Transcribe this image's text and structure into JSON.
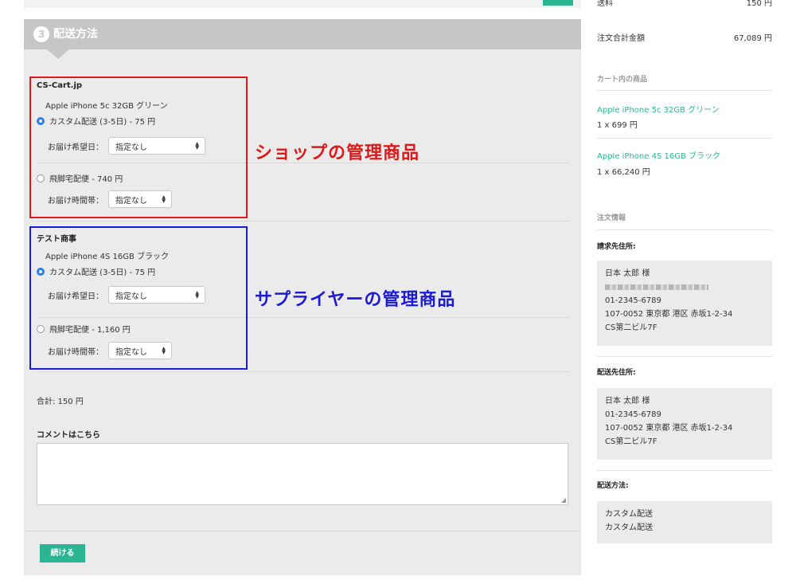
{
  "top": {
    "right_label": "送料",
    "right_value": "150 円"
  },
  "step": {
    "number": "3",
    "title": "配送方法"
  },
  "vendors": [
    {
      "name": "CS-Cart.jp",
      "product": "Apple iPhone 5c 32GB グリーン",
      "option1": "カスタム配送 (3-5日) - 75 円",
      "date_label": "お届け希望日：",
      "date_value": "指定なし",
      "option2": "飛脚宅配便 - 740 円",
      "time_label": "お届け時間帯：",
      "time_value": "指定なし"
    },
    {
      "name": "テスト商事",
      "product": "Apple iPhone 4S 16GB ブラック",
      "option1": "カスタム配送 (3-5日) - 75 円",
      "date_label": "お届け希望日：",
      "date_value": "指定なし",
      "option2": "飛脚宅配便 - 1,160 円",
      "time_label": "お届け時間帯：",
      "time_value": "指定なし"
    }
  ],
  "annotations": {
    "shop": "ショップの管理商品",
    "supplier": "サプライヤーの管理商品"
  },
  "total": "合計: 150 円",
  "comment_label": "コメントはこちら",
  "comment_value": "",
  "continue_label": "続ける",
  "summary": {
    "total_label": "注文合計金額",
    "total_value": "67,089 円",
    "cart_heading": "カート内の商品",
    "items": [
      {
        "name": "Apple iPhone 5c 32GB グリーン",
        "qty": "1 x 699 円"
      },
      {
        "name": "Apple iPhone 4S 16GB ブラック",
        "qty": "1 x 66,240 円"
      }
    ],
    "order_info_heading": "注文情報",
    "billing_label": "請求先住所:",
    "billing": {
      "name": "日本 太郎 様",
      "phone": "01-2345-6789",
      "address": "107-0052 東京都 港区 赤坂1-2-34",
      "building": "CS第二ビル7F"
    },
    "shipping_label": "配送先住所:",
    "shipping": {
      "name": "日本 太郎 様",
      "phone": "01-2345-6789",
      "address": "107-0052 東京都 港区 赤坂1-2-34",
      "building": "CS第二ビル7F"
    },
    "method_label": "配送方法:",
    "methods": [
      "カスタム配送",
      "カスタム配送"
    ]
  },
  "colors": {
    "accent": "#2cb592",
    "radio": "#2b7de9",
    "shop_box": "#e01818",
    "supplier_box": "#1a1ad8",
    "header": "#c4c6c8"
  }
}
